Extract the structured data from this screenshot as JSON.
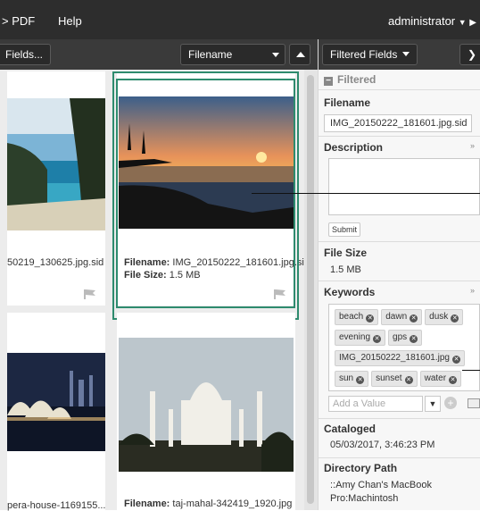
{
  "topbar": {
    "menu_pdf": "PDF",
    "menu_help": "Help",
    "user": "administrator"
  },
  "toolbar": {
    "fields_btn": "Fields...",
    "sort_select": "Filename"
  },
  "grid": {
    "cards": [
      {
        "filename": "50219_130625.jpg.sid"
      },
      {
        "filename_label": "Filename:",
        "filename": "IMG_20150222_181601.jpg.sid",
        "filesize_label": "File Size:",
        "filesize": "1.5 MB"
      },
      {
        "filename": "pera-house-1169155..."
      },
      {
        "filename_label": "Filename:",
        "filename": "taj-mahal-342419_1920.jpg"
      }
    ]
  },
  "panel": {
    "header_btn": "Filtered Fields",
    "filtered_label": "Filtered",
    "filename_label": "Filename",
    "filename_value": "IMG_20150222_181601.jpg.sid",
    "description_label": "Description",
    "submit": "Submit",
    "filesize_label": "File Size",
    "filesize_value": "1.5 MB",
    "keywords_label": "Keywords",
    "keywords": [
      "beach",
      "dawn",
      "dusk",
      "evening",
      "gps",
      "IMG_20150222_181601.jpg",
      "sun",
      "sunset",
      "water"
    ],
    "add_value_placeholder": "Add a Value",
    "cataloged_label": "Cataloged",
    "cataloged_value": "05/03/2017, 3:46:23 PM",
    "dirpath_label": "Directory Path",
    "dirpath_line1": "::Amy Chan's MacBook",
    "dirpath_line2": "Pro:Machintosh"
  }
}
